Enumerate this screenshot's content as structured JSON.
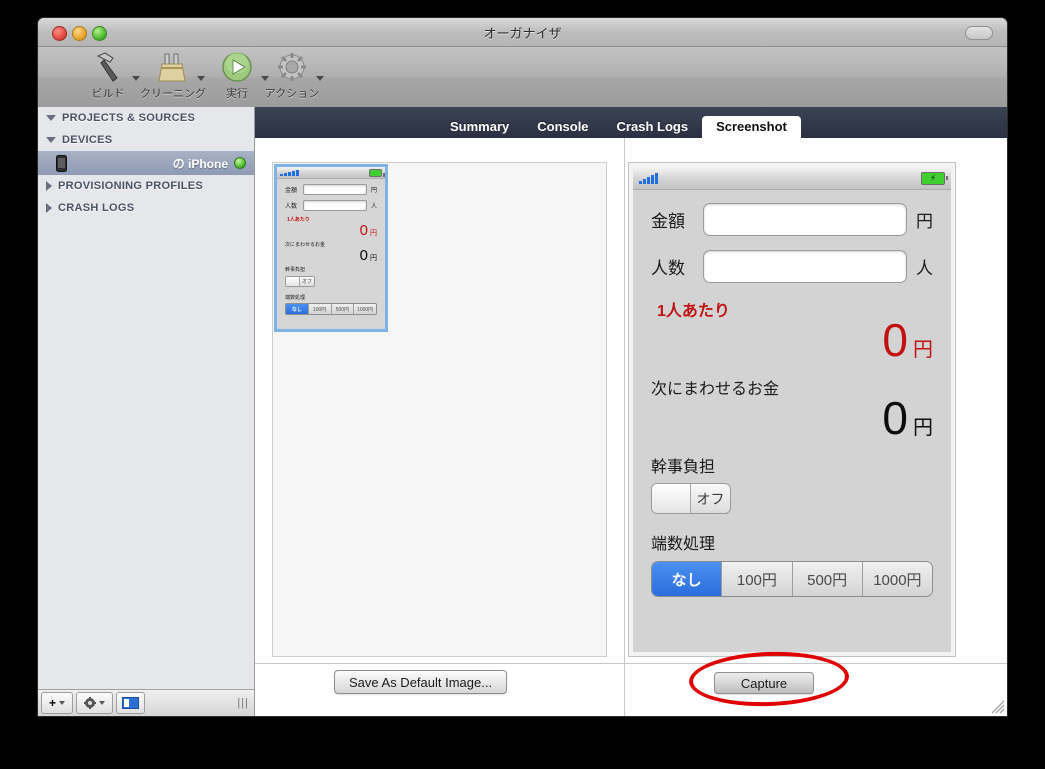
{
  "window": {
    "title": "オーガナイザ",
    "traffic_lights": [
      "close",
      "minimize",
      "zoom"
    ],
    "toolbar_pill": "toolbar-toggle"
  },
  "toolbar": {
    "items": [
      {
        "label": "ビルド",
        "icon": "hammer-icon",
        "has_menu": true
      },
      {
        "label": "クリーニング",
        "icon": "broom-icon",
        "has_menu": true
      },
      {
        "label": "実行",
        "icon": "play-icon",
        "has_menu": true
      },
      {
        "label": "アクション",
        "icon": "gear-icon",
        "has_menu": true
      }
    ]
  },
  "sidebar": {
    "groups": [
      {
        "label": "PROJECTS & SOURCES",
        "expanded": true
      },
      {
        "label": "DEVICES",
        "expanded": true
      },
      {
        "label": "PROVISIONING PROFILES",
        "expanded": false
      },
      {
        "label": "CRASH LOGS",
        "expanded": false
      }
    ],
    "device": {
      "name": "の iPhone",
      "icon": "iphone-icon",
      "status": "connected"
    },
    "bottom_bar": {
      "add_label": "+",
      "add_icon": "plus-icon",
      "gear_icon": "gear-icon",
      "panel_icon": "panel-toggle-icon",
      "grip": "|||"
    }
  },
  "tabs": [
    {
      "label": "Summary",
      "active": false
    },
    {
      "label": "Console",
      "active": false
    },
    {
      "label": "Crash Logs",
      "active": false
    },
    {
      "label": "Screenshot",
      "active": true
    }
  ],
  "left_pane": {
    "thumbnail_selected": true,
    "save_button": "Save As Default Image..."
  },
  "right_pane": {
    "capture_button": "Capture",
    "annotation": "red-ellipse-highlight"
  },
  "device_screen": {
    "status_bar": {
      "signal_icon": "signal-bars-icon",
      "battery_icon": "battery-charging-icon"
    },
    "fields": [
      {
        "label": "金額",
        "value": "",
        "unit": "円"
      },
      {
        "label": "人数",
        "value": "",
        "unit": "人"
      }
    ],
    "per_person": {
      "heading": "1人あたり",
      "value": "0",
      "unit": "円",
      "color": "#c01212"
    },
    "carry_over": {
      "heading": "次にまわせるお金",
      "value": "0",
      "unit": "円",
      "color": "#0d0d0d"
    },
    "organizer": {
      "heading": "幹事負担",
      "toggle_state": "オフ"
    },
    "rounding": {
      "heading": "端数処理",
      "options": [
        "なし",
        "100円",
        "500円",
        "1000円"
      ],
      "selected_index": 0,
      "selected_color": "#2a6fdc"
    }
  }
}
